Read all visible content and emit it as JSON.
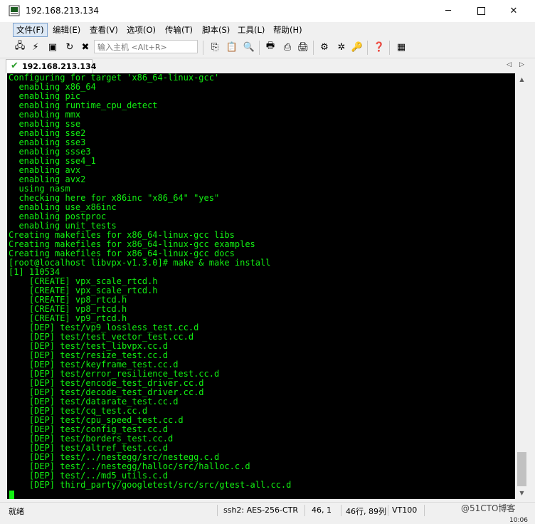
{
  "window": {
    "title": "192.168.213.134"
  },
  "menu": [
    "文件(F)",
    "编辑(E)",
    "查看(V)",
    "选项(O)",
    "传输(T)",
    "脚本(S)",
    "工具(L)",
    "帮助(H)"
  ],
  "toolbar": {
    "host_placeholder": "输入主机 <Alt+R>"
  },
  "tab": {
    "label": "192.168.213.134"
  },
  "terminal": {
    "lines": [
      "Configuring for target 'x86_64-linux-gcc'",
      "  enabling x86_64",
      "  enabling pic",
      "  enabling runtime_cpu_detect",
      "  enabling mmx",
      "  enabling sse",
      "  enabling sse2",
      "  enabling sse3",
      "  enabling ssse3",
      "  enabling sse4_1",
      "  enabling avx",
      "  enabling avx2",
      "  using nasm",
      "  checking here for x86inc \"x86_64\" \"yes\"",
      "  enabling use_x86inc",
      "  enabling postproc",
      "  enabling unit_tests",
      "Creating makefiles for x86_64-linux-gcc libs",
      "Creating makefiles for x86_64-linux-gcc examples",
      "Creating makefiles for x86_64-linux-gcc docs",
      "[root@localhost libvpx-v1.3.0]# make & make install",
      "[1] 110534",
      "    [CREATE] vpx_scale_rtcd.h",
      "    [CREATE] vpx_scale_rtcd.h",
      "    [CREATE] vp8_rtcd.h",
      "    [CREATE] vp8_rtcd.h",
      "    [CREATE] vp9_rtcd.h",
      "    [DEP] test/vp9_lossless_test.cc.d",
      "    [DEP] test/test_vector_test.cc.d",
      "    [DEP] test/test_libvpx.cc.d",
      "    [DEP] test/resize_test.cc.d",
      "    [DEP] test/keyframe_test.cc.d",
      "    [DEP] test/error_resilience_test.cc.d",
      "    [DEP] test/encode_test_driver.cc.d",
      "    [DEP] test/decode_test_driver.cc.d",
      "    [DEP] test/datarate_test.cc.d",
      "    [DEP] test/cq_test.cc.d",
      "    [DEP] test/cpu_speed_test.cc.d",
      "    [DEP] test/config_test.cc.d",
      "    [DEP] test/borders_test.cc.d",
      "    [DEP] test/altref_test.cc.d",
      "    [DEP] test/../nestegg/src/nestegg.c.d",
      "    [DEP] test/../nestegg/halloc/src/halloc.c.d",
      "    [DEP] test/../md5_utils.c.d",
      "    [DEP] third_party/googletest/src/src/gtest-all.cc.d"
    ]
  },
  "status": {
    "ready": "就绪",
    "cipher": "ssh2: AES-256-CTR",
    "position": "46,  1",
    "size": "46行, 89列",
    "term_type": "VT100"
  },
  "watermark": "@51CTO博客",
  "clock": "10:06",
  "colors": {
    "terminal_fg": "#12f012",
    "terminal_bg": "#000000"
  }
}
